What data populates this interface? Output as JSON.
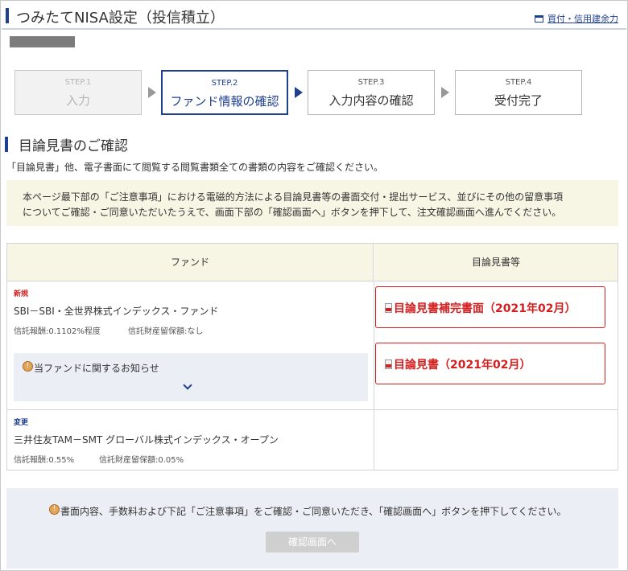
{
  "header": {
    "title": "つみたてNISA設定（投信積立）",
    "link_label": "買付・信用建余力"
  },
  "steps": [
    {
      "num": "STEP.1",
      "name": "入力",
      "state": "done"
    },
    {
      "num": "STEP.2",
      "name": "ファンド情報の確認",
      "state": "active"
    },
    {
      "num": "STEP.3",
      "name": "入力内容の確認",
      "state": "upcoming"
    },
    {
      "num": "STEP.4",
      "name": "受付完了",
      "state": "upcoming"
    }
  ],
  "section": {
    "title": "目論見書のご確認",
    "intro": "「目論見書」他、電子書面にて閲覧する閲覧書類全ての書類の内容をご確認ください。",
    "notice_line1": "本ページ最下部の「ご注意事項」における電磁的方法による目論見書等の書面交付・提出サービス、並びにその他の留意事項",
    "notice_line2": "についてご確認・ご同意いただいたうえで、画面下部の「確認画面へ」ボタンを押下して、注文確認画面へ進んでください。"
  },
  "table": {
    "col_fund": "ファンド",
    "col_docs": "目論見書等",
    "rows": [
      {
        "tag": "新規",
        "fund_name": "SBI－SBI・全世界株式インデックス・ファンド",
        "fee": "信託報酬:0.1102%程度",
        "reserve": "信託財産留保額:なし",
        "info_label": "当ファンドに関するお知らせ",
        "docs": [
          "目論見書補完書面（2021年02月）",
          "目論見書（2021年02月）"
        ]
      },
      {
        "tag": "変更",
        "fund_name": "三井住友TAM－SMT グローバル株式インデックス・オープン",
        "fee": "信託報酬:0.55%",
        "reserve": "信託財産留保額:0.05%"
      }
    ]
  },
  "footer": {
    "message": "書面内容、手数料および下記「ご注意事項」をご確認・ご同意いただき、「確認画面へ」ボタンを押下してください。",
    "confirm_button": "確認画面へ"
  },
  "colors": {
    "brand_blue": "#1f3f8f",
    "alert_red": "#d31f1f",
    "notice_bg": "#f7f6e5",
    "info_bg": "#eceef6"
  }
}
